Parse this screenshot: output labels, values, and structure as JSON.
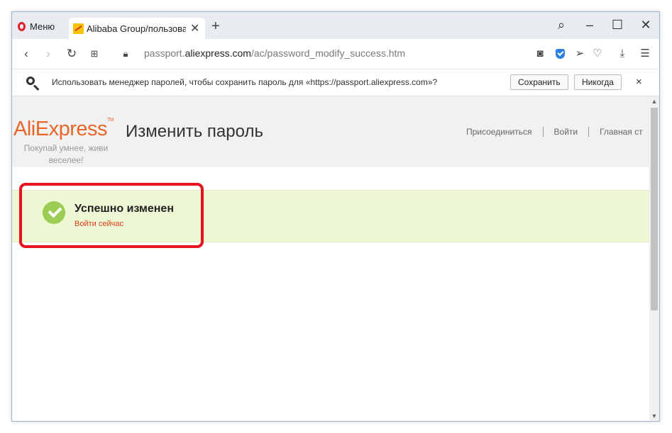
{
  "browser": {
    "menu_label": "Меню",
    "tab_title": "Alibaba Group/пользовате",
    "url_prefix": "passport.",
    "url_host": "aliexpress.com",
    "url_path": "/ac/password_modify_success.htm"
  },
  "password_bar": {
    "message": "Использовать менеджер паролей, чтобы сохранить пароль для «https://passport.aliexpress.com»?",
    "save_label": "Сохранить",
    "never_label": "Никогда",
    "close_glyph": "×"
  },
  "site": {
    "logo_text": "AliExpress",
    "logo_tm": "TM",
    "slogan_line1": "Покупай умнее, живи",
    "slogan_line2": "веселее!",
    "page_title": "Изменить пароль",
    "nav": {
      "join": "Присоединиться",
      "login": "Войти",
      "home": "Главная ст"
    }
  },
  "success": {
    "title": "Успешно изменен",
    "link": "Войти сейчас"
  },
  "colors": {
    "accent_logo": "#e8662a",
    "success_band": "#eef7d4",
    "check": "#9ccc52",
    "highlight": "#e7131f",
    "link": "#e0401c"
  }
}
